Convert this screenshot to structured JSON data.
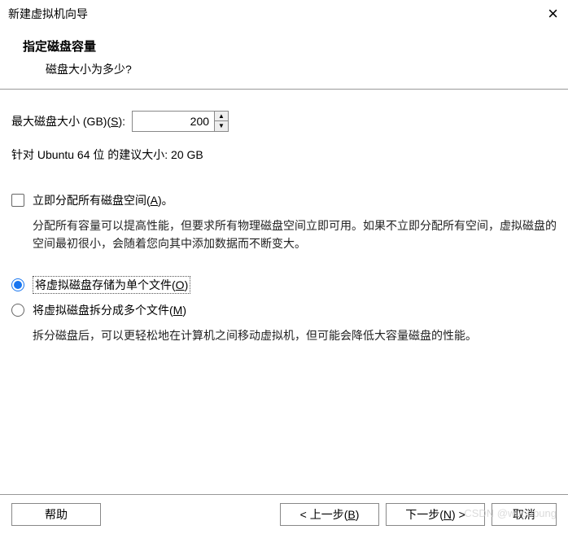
{
  "window": {
    "title": "新建虚拟机向导"
  },
  "header": {
    "title": "指定磁盘容量",
    "subtitle": "磁盘大小为多少?"
  },
  "disk": {
    "size_label_prefix": "最大磁盘大小 (GB)(",
    "size_label_hotkey": "S",
    "size_label_suffix": "):",
    "size_value": "200",
    "recommend": "针对 Ubuntu 64 位 的建议大小: 20 GB"
  },
  "allocate": {
    "label_prefix": "立即分配所有磁盘空间(",
    "label_hotkey": "A",
    "label_suffix": ")。",
    "desc": "分配所有容量可以提高性能，但要求所有物理磁盘空间立即可用。如果不立即分配所有空间，虚拟磁盘的空间最初很小，会随着您向其中添加数据而不断变大。"
  },
  "store": {
    "single_prefix": "将虚拟磁盘存储为单个文件(",
    "single_hotkey": "O",
    "single_suffix": ")",
    "split_prefix": "将虚拟磁盘拆分成多个文件(",
    "split_hotkey": "M",
    "split_suffix": ")",
    "split_desc": "拆分磁盘后，可以更轻松地在计算机之间移动虚拟机，但可能会降低大容量磁盘的性能。"
  },
  "buttons": {
    "help": "帮助",
    "prev_prefix": "< 上一步(",
    "prev_hotkey": "B",
    "prev_suffix": ")",
    "next_prefix": "下一步(",
    "next_hotkey": "N",
    "next_suffix": ") >",
    "cancel": "取消"
  },
  "watermark": "CSDN @wupupung"
}
